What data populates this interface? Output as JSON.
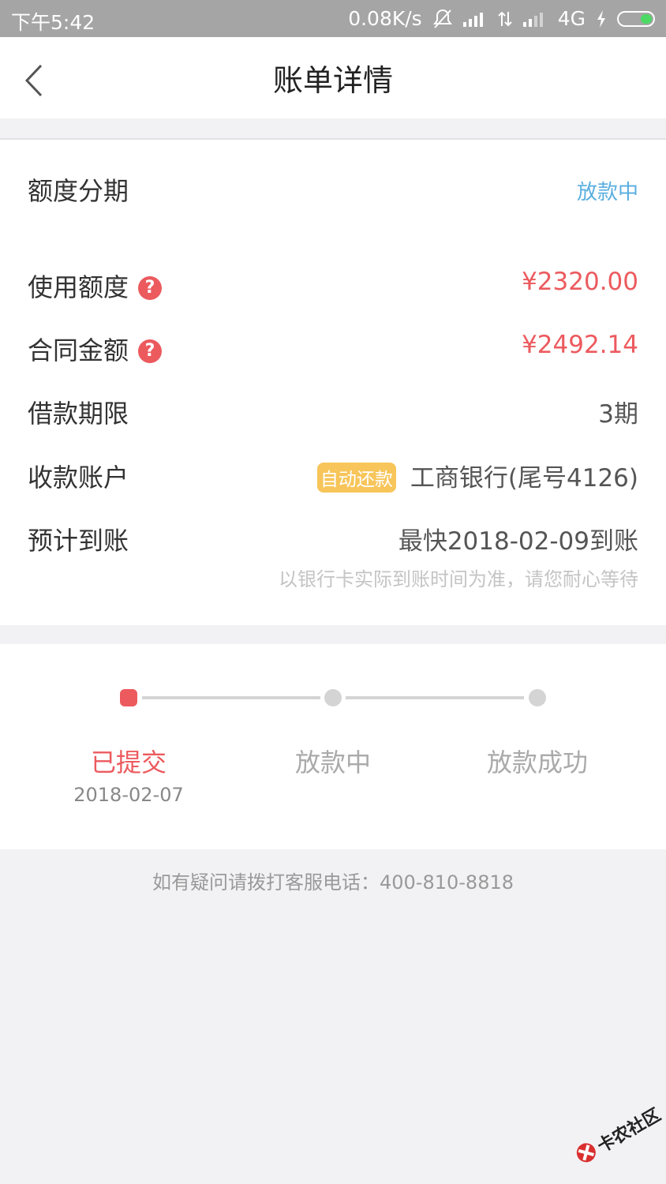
{
  "status_bar": {
    "time": "下午5:42",
    "net_speed": "0.08K/s",
    "network": "4G",
    "battery_color": "#4cd964"
  },
  "nav": {
    "title": "账单详情",
    "back_icon": "chevron-left-icon"
  },
  "product": {
    "label": "额度分期",
    "status": "放款中"
  },
  "details": {
    "used_label": "使用额度",
    "used_value": "¥2320.00",
    "contract_label": "合同金额",
    "contract_value": "¥2492.14",
    "term_label": "借款期限",
    "term_value": "3期",
    "account_label": "收款账户",
    "account_tag": "自动还款",
    "account_value": "工商银行(尾号4126)",
    "arrival_label": "预计到账",
    "arrival_value": "最快2018-02-09到账",
    "arrival_hint": "以银行卡实际到账时间为准，请您耐心等待",
    "help_glyph": "?"
  },
  "progress": {
    "steps": [
      {
        "label": "已提交",
        "date": "2018-02-07",
        "active": true
      },
      {
        "label": "放款中",
        "date": "",
        "active": false
      },
      {
        "label": "放款成功",
        "date": "",
        "active": false
      }
    ]
  },
  "footer": {
    "contact": "如有疑问请拨打客服电话：400-810-8818"
  },
  "watermark": {
    "text": "卡农社区"
  },
  "colors": {
    "accent_red": "#ec5a5e",
    "status_blue": "#5aaee0",
    "tag_orange": "#f7c55a"
  }
}
